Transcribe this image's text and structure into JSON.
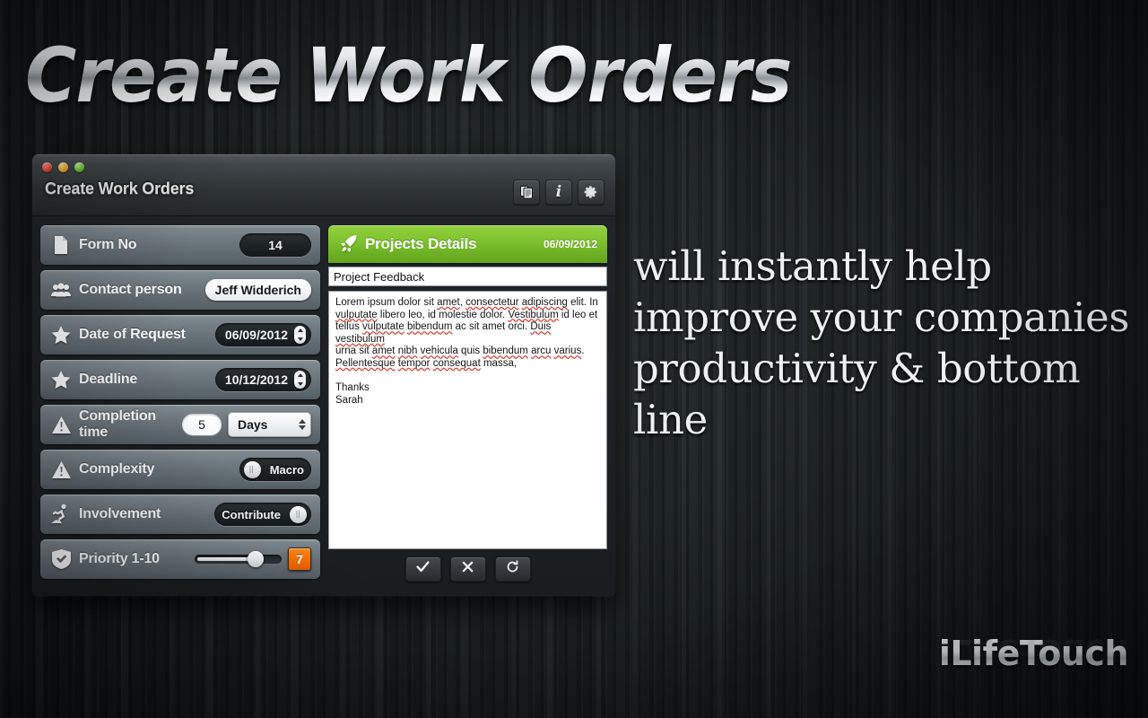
{
  "page": {
    "headline": "Create Work Orders",
    "promo_text": "will instantly help improve your companies productivity & bottom line",
    "brand": "iLifeTouch",
    "accent_green": "#7fc22f",
    "accent_orange": "#fb6f00"
  },
  "window": {
    "title": "Create Work Orders",
    "toolbar": {
      "copy_icon": "documents-icon",
      "info_icon": "info-icon",
      "info_glyph": "i",
      "settings_icon": "gear-icon"
    },
    "traffic_lights": [
      "close",
      "minimize",
      "zoom"
    ]
  },
  "form": {
    "rows": [
      {
        "icon": "document-icon",
        "label": "Form No",
        "type": "badge",
        "value": "14"
      },
      {
        "icon": "people-icon",
        "label": "Contact person",
        "type": "text",
        "value": "Jeff Widderich"
      },
      {
        "icon": "star-icon",
        "label": "Date of Request",
        "type": "date",
        "value": "06/09/2012"
      },
      {
        "icon": "star-icon",
        "label": "Deadline",
        "type": "date",
        "value": "10/12/2012"
      },
      {
        "icon": "warning-icon",
        "label": "Completion time",
        "type": "number-unit",
        "value": "5",
        "unit": "Days"
      },
      {
        "icon": "warning-icon",
        "label": "Complexity",
        "type": "toggle-left",
        "value": "Macro"
      },
      {
        "icon": "worker-icon",
        "label": "Involvement",
        "type": "toggle-right",
        "value": "Contribute"
      },
      {
        "icon": "shield-check-icon",
        "label": "Priority 1-10",
        "type": "slider",
        "value": "7",
        "percent": 67
      }
    ],
    "unit_options": [
      "Days"
    ]
  },
  "details": {
    "title": "Projects Details",
    "icon": "rocket-icon",
    "date": "06/09/2012",
    "subject": "Project Feedback",
    "body_lines": [
      "Lorem ipsum dolor sit amet, consectetur adipiscing elit. In",
      "vulputate libero leo, id molestie dolor. Vestibulum id leo et",
      "tellus vulputate bibendum ac sit amet orci. Duis vestibulum",
      "urna sit amet nibh vehicula quis bibendum arcu varius.",
      "Pellentesque tempor consequat massa,"
    ],
    "signoff_lines": [
      "Thanks",
      "Sarah"
    ],
    "actions": [
      {
        "name": "confirm",
        "icon": "check-icon"
      },
      {
        "name": "cancel",
        "icon": "close-icon"
      },
      {
        "name": "refresh",
        "icon": "refresh-icon"
      }
    ]
  }
}
